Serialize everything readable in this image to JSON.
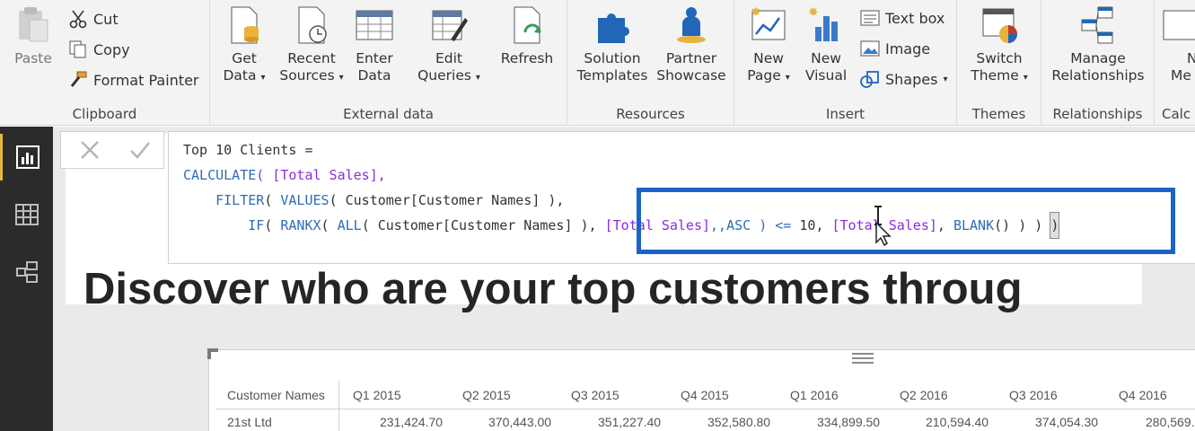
{
  "ribbon": {
    "clipboard": {
      "label": "Clipboard",
      "paste": "Paste",
      "cut": "Cut",
      "copy": "Copy",
      "format_painter": "Format Painter"
    },
    "external_data": {
      "label": "External data",
      "get_data": [
        "Get",
        "Data"
      ],
      "recent_sources": [
        "Recent",
        "Sources"
      ],
      "enter_data": [
        "Enter",
        "Data"
      ],
      "edit_queries": [
        "Edit",
        "Queries"
      ],
      "refresh": "Refresh"
    },
    "resources": {
      "label": "Resources",
      "solution_templates": [
        "Solution",
        "Templates"
      ],
      "partner_showcase": [
        "Partner",
        "Showcase"
      ]
    },
    "insert": {
      "label": "Insert",
      "new_page": [
        "New",
        "Page"
      ],
      "new_visual": [
        "New",
        "Visual"
      ],
      "text_box": "Text box",
      "image": "Image",
      "shapes": "Shapes"
    },
    "themes": {
      "label": "Themes",
      "switch_theme": [
        "Switch",
        "Theme"
      ]
    },
    "relationships": {
      "label": "Relationships",
      "manage_relationships": [
        "Manage",
        "Relationships"
      ]
    },
    "calc": {
      "label": "Calc",
      "new_measure_partial": [
        "N",
        "Me"
      ]
    },
    "caret": "▾"
  },
  "formula": {
    "line1": "Top 10 Clients =",
    "line2_fn": "CALCULATE",
    "line2_rest": "( [Total Sales],",
    "line3_fn": "FILTER",
    "line3_a": "( ",
    "line3_fn2": "VALUES",
    "line3_b": "( Customer[Customer Names] ),",
    "line4_fn": "IF",
    "line4_a": "( ",
    "line4_fn2": "RANKX",
    "line4_b": "( ",
    "line4_fn3": "ALL",
    "line4_c": "( Customer[Customer Names] ), ",
    "line4_measure": "[Total Sales]",
    "line4_d": ",,ASC ) <= ",
    "line4_num": "10",
    "line4_e": ", ",
    "line4_measure2": "[Total Sales]",
    "line4_f": ", ",
    "line4_fn4": "BLANK",
    "line4_g": "() ) ) ",
    "line4_last": ")"
  },
  "heading": "Discover who are your top customers throug",
  "table": {
    "columns": [
      "Customer Names",
      "Q1 2015",
      "Q2 2015",
      "Q3 2015",
      "Q4 2015",
      "Q1 2016",
      "Q2 2016",
      "Q3 2016",
      "Q4 2016"
    ],
    "rows": [
      [
        "21st Ltd",
        "231,424.70",
        "370,443.00",
        "351,227.40",
        "352,580.80",
        "334,899.50",
        "210,594.40",
        "374,054.30",
        "280,569."
      ]
    ]
  },
  "colors": {
    "highlight_border": "#1a64c8",
    "dax_keyword": "#2f6cb5",
    "dax_measure": "#8a2be2",
    "nav_bg": "#2b2b2b",
    "nav_accent": "#e8b83a"
  }
}
